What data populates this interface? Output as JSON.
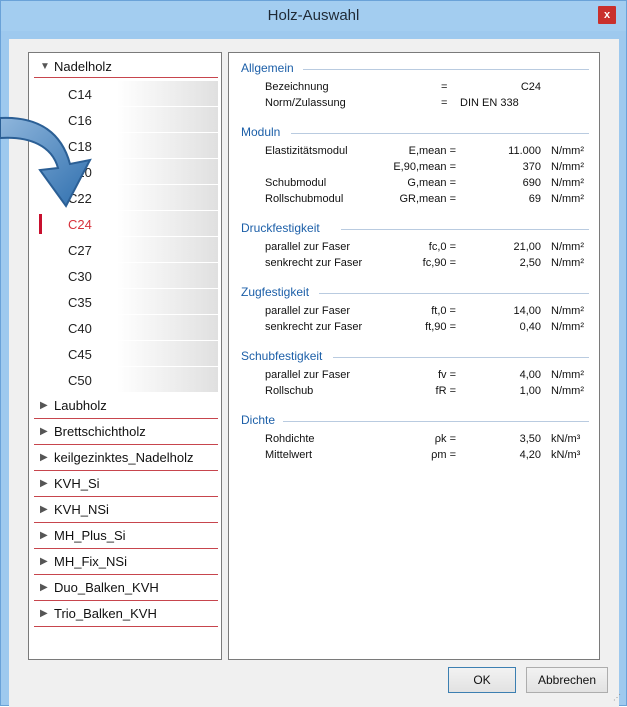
{
  "window": {
    "title": "Holz-Auswahl",
    "close_label": "x"
  },
  "tree": {
    "expanded_group": "Nadelholz",
    "children": [
      "C14",
      "C16",
      "C18",
      "C20",
      "C22",
      "C24",
      "C27",
      "C30",
      "C35",
      "C40",
      "C45",
      "C50"
    ],
    "selected": "C24",
    "collapsed_groups": [
      "Laubholz",
      "Brettschichtholz",
      "keilgezinktes_Nadelholz",
      "KVH_Si",
      "KVH_NSi",
      "MH_Plus_Si",
      "MH_Fix_NSi",
      "Duo_Balken_KVH",
      "Trio_Balken_KVH"
    ]
  },
  "details": {
    "allgemein": {
      "title": "Allgemein",
      "rows": [
        {
          "name": "Bezeichnung",
          "sym": "=",
          "value": "C24"
        },
        {
          "name": "Norm/Zulassung",
          "sym": "=",
          "value": "DIN EN 338"
        }
      ]
    },
    "moduln": {
      "title": "Moduln",
      "rows": [
        {
          "name": "Elastizitätsmodul",
          "sym": "E,mean =",
          "value": "11.000",
          "unit": "N/mm²"
        },
        {
          "name": "",
          "sym": "E,90,mean =",
          "value": "370",
          "unit": "N/mm²"
        },
        {
          "name": "Schubmodul",
          "sym": "G,mean =",
          "value": "690",
          "unit": "N/mm²"
        },
        {
          "name": "Rollschubmodul",
          "sym": "GR,mean =",
          "value": "69",
          "unit": "N/mm²"
        }
      ]
    },
    "druck": {
      "title": "Druckfestigkeit",
      "rows": [
        {
          "name": "parallel zur Faser",
          "sym": "fc,0 =",
          "value": "21,00",
          "unit": "N/mm²"
        },
        {
          "name": "senkrecht zur Faser",
          "sym": "fc,90 =",
          "value": "2,50",
          "unit": "N/mm²"
        }
      ]
    },
    "zug": {
      "title": "Zugfestigkeit",
      "rows": [
        {
          "name": "parallel zur Faser",
          "sym": "ft,0 =",
          "value": "14,00",
          "unit": "N/mm²"
        },
        {
          "name": "senkrecht zur Faser",
          "sym": "ft,90 =",
          "value": "0,40",
          "unit": "N/mm²"
        }
      ]
    },
    "schub": {
      "title": "Schubfestigkeit",
      "rows": [
        {
          "name": "parallel zur Faser",
          "sym": "fv =",
          "value": "4,00",
          "unit": "N/mm²"
        },
        {
          "name": "Rollschub",
          "sym": "fR =",
          "value": "1,00",
          "unit": "N/mm²"
        }
      ]
    },
    "dichte": {
      "title": "Dichte",
      "rows": [
        {
          "name": "Rohdichte",
          "sym": "ρk =",
          "value": "3,50",
          "unit": "kN/m³"
        },
        {
          "name": "Mittelwert",
          "sym": "ρm =",
          "value": "4,20",
          "unit": "kN/m³"
        }
      ]
    }
  },
  "buttons": {
    "ok": "OK",
    "cancel": "Abbrechen"
  },
  "colors": {
    "accent": "#c8102e",
    "section": "#1c5fa8",
    "titlebar": "#a3cdf0"
  },
  "icons": {
    "expanded": "triangle-down-icon",
    "collapsed": "triangle-right-icon",
    "close": "close-icon",
    "pointer": "arrow-pointer-icon"
  }
}
